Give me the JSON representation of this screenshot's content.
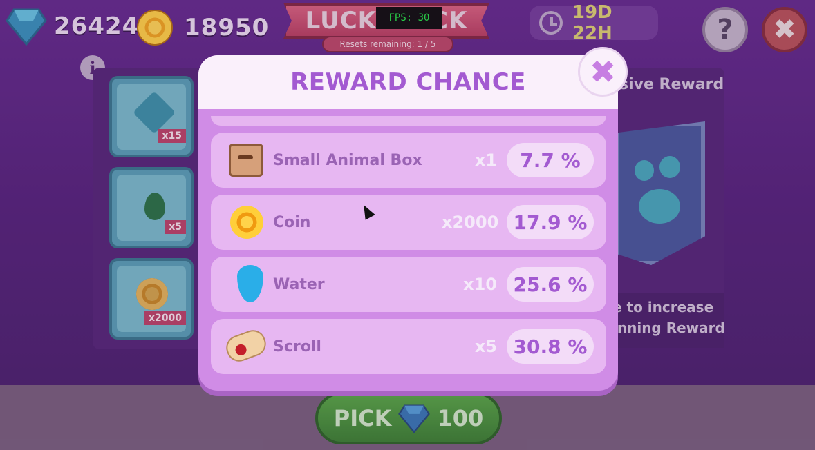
{
  "top_bar": {
    "gems": "26424",
    "coins": "18950",
    "title": "LUCKY PICK",
    "resets": "Resets remaining: 1 / 5",
    "fps": "FPS: 30",
    "timer": "19D 22H",
    "help_glyph": "?",
    "close_glyph": "✖"
  },
  "info_glyph": "i",
  "left_tiles": [
    {
      "icon": "leaf-icon",
      "qty": "x15"
    },
    {
      "icon": "green-drop-icon",
      "qty": "x5"
    },
    {
      "icon": "coin-icon",
      "qty": "x2000"
    }
  ],
  "right_panel": {
    "title": "sive Reward",
    "desc_line1": "e to increase",
    "desc_line2": "inning Rewards!"
  },
  "pick_button": {
    "label": "PICK",
    "cost": "100"
  },
  "modal": {
    "title": "REWARD CHANCE",
    "close_glyph": "✖",
    "rows": [
      {
        "icon": "animal-box-icon",
        "name": "Small Animal Box",
        "qty": "x1",
        "pct": "7.7 %"
      },
      {
        "icon": "coin-icon",
        "name": "Coin",
        "qty": "x2000",
        "pct": "17.9 %"
      },
      {
        "icon": "water-drop-icon",
        "name": "Water",
        "qty": "x10",
        "pct": "25.6 %"
      },
      {
        "icon": "scroll-icon",
        "name": "Scroll",
        "qty": "x5",
        "pct": "30.8 %"
      }
    ]
  },
  "colors": {
    "background": "#4a1773",
    "modal": "#d08ce6",
    "modal_header": "#faf0fb",
    "title_text": "#a35ad1",
    "pick_button": "#3a8f2f"
  }
}
